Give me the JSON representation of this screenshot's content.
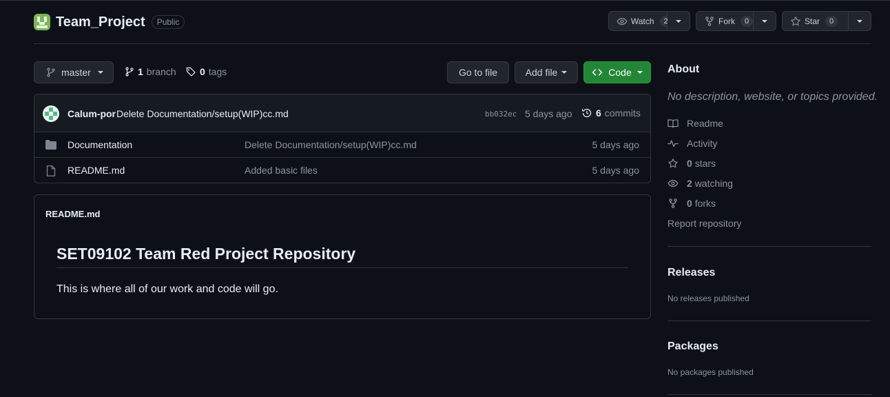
{
  "repo": {
    "name": "Team_Project",
    "visibility": "Public"
  },
  "header_actions": {
    "watch_label": "Watch",
    "watch_count": "2",
    "fork_label": "Fork",
    "fork_count": "0",
    "star_label": "Star",
    "star_count": "0"
  },
  "branch": {
    "current": "master",
    "branches_count": "1",
    "branches_label": "branch",
    "tags_count": "0",
    "tags_label": "tags"
  },
  "toolbar": {
    "go_to_file": "Go to file",
    "add_file": "Add file",
    "code": "Code"
  },
  "latest_commit": {
    "author": "Calum-por",
    "message": "Delete Documentation/setup(WIP)cc.md",
    "sha": "bb032ec",
    "age": "5 days ago",
    "commits_count": "6",
    "commits_label": "commits"
  },
  "files": [
    {
      "type": "folder",
      "name": "Documentation",
      "commit": "Delete Documentation/setup(WIP)cc.md",
      "age": "5 days ago"
    },
    {
      "type": "file",
      "name": "README.md",
      "commit": "Added basic files",
      "age": "5 days ago"
    }
  ],
  "readme": {
    "filename": "README.md",
    "heading": "SET09102 Team Red Project Repository",
    "body": "This is where all of our work and code will go."
  },
  "about": {
    "title": "About",
    "description": "No description, website, or topics provided.",
    "readme": "Readme",
    "activity": "Activity",
    "stars_count": "0",
    "stars_label": "stars",
    "watching_count": "2",
    "watching_label": "watching",
    "forks_count": "0",
    "forks_label": "forks",
    "report": "Report repository"
  },
  "releases": {
    "title": "Releases",
    "empty": "No releases published"
  },
  "packages": {
    "title": "Packages",
    "empty": "No packages published"
  },
  "colors": {
    "background": "#0d1117",
    "border": "#30363d",
    "muted_text": "#8b949e",
    "primary_button": "#238636"
  }
}
